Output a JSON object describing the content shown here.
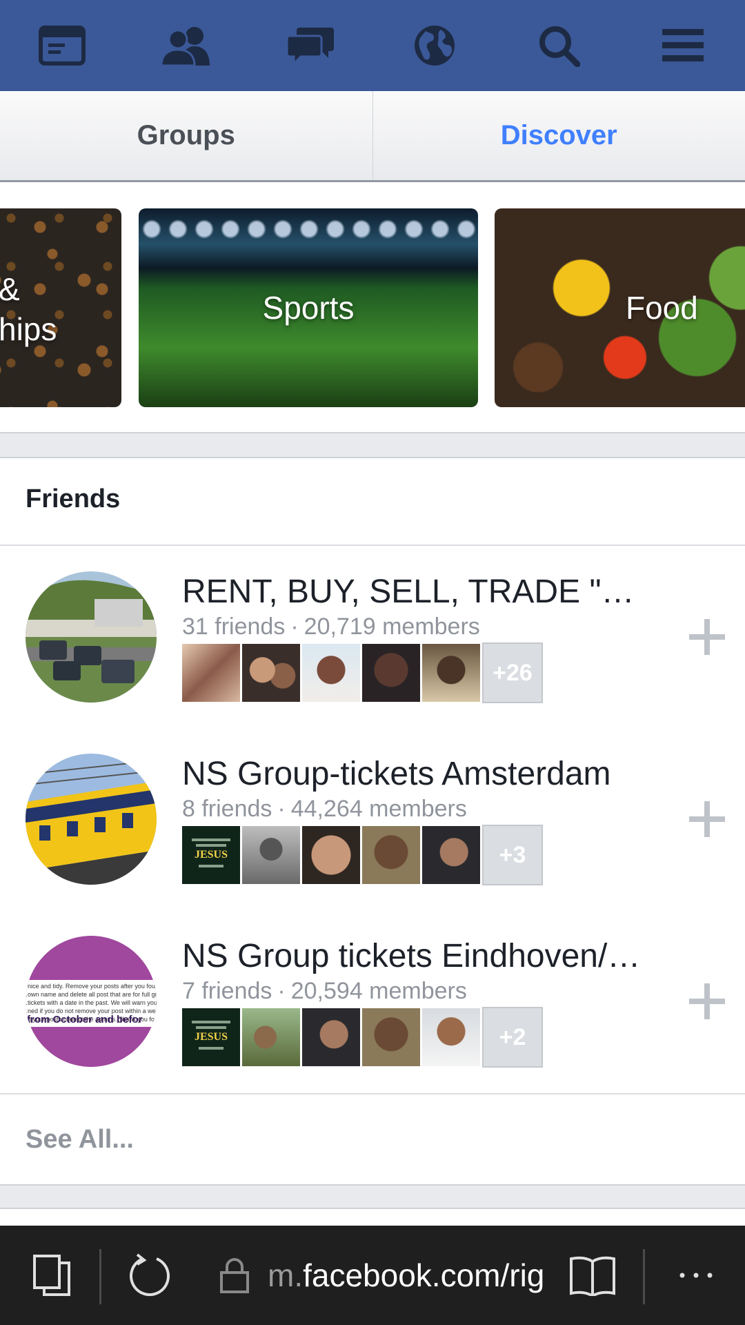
{
  "nav": {
    "icons": [
      "news-feed-icon",
      "friends-icon",
      "messages-icon",
      "notifications-globe-icon",
      "search-icon",
      "menu-icon"
    ]
  },
  "tabs": {
    "groups_label": "Groups",
    "discover_label": "Discover",
    "active": "Discover"
  },
  "categories": [
    {
      "label": "& hips",
      "line1": "&",
      "line2": "hips"
    },
    {
      "label": "Sports"
    },
    {
      "label": "Food"
    }
  ],
  "friends_section": {
    "title": "Friends",
    "groups": [
      {
        "name": "RENT, BUY, SELL, TRADE \"…",
        "friends": "31 friends",
        "members": "20,719 members",
        "more": "+26"
      },
      {
        "name": "NS Group-tickets Amsterdam",
        "friends": "8 friends",
        "members": "44,264 members",
        "more": "+3"
      },
      {
        "name": "NS Group tickets Eindhoven/…",
        "friends": "7 friends",
        "members": "20,594 members",
        "more": "+2",
        "avatar_text_lines": [
          "…nice and tidy. Remove your posts after you four.",
          "…own name and delete all post that are for full gro…",
          "…tickets with a date in the past. We will warn you on…",
          "…ned if you do not remove your post within a week. If…",
          "…g your posts contact the admins. Thank you for your…"
        ],
        "avatar_banner": "from October and befor"
      }
    ],
    "see_all": "See All..."
  },
  "browser": {
    "url_prefix": "m.",
    "url_host": "facebook.com/rigi"
  },
  "colors": {
    "brand": "#3b5998",
    "active_tab": "#4080ff",
    "muted": "#90949c"
  }
}
